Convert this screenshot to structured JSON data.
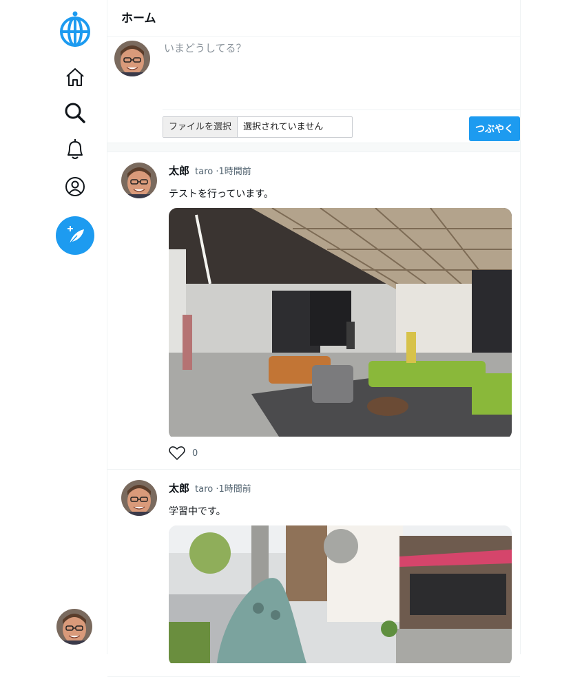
{
  "header": {
    "title": "ホーム"
  },
  "composer": {
    "placeholder": "いまどうしてる？",
    "file_button": "ファイルを選択",
    "file_status": "選択されていません",
    "submit_label": "つぶやく"
  },
  "posts": [
    {
      "name": "太郎",
      "handle": "taro",
      "time": "·1時間前",
      "text": "テストを行っています。",
      "likes": "0"
    },
    {
      "name": "太郎",
      "handle": "taro",
      "time": "·1時間前",
      "text": "学習中です。"
    }
  ],
  "colors": {
    "accent": "#1d9bf0"
  }
}
